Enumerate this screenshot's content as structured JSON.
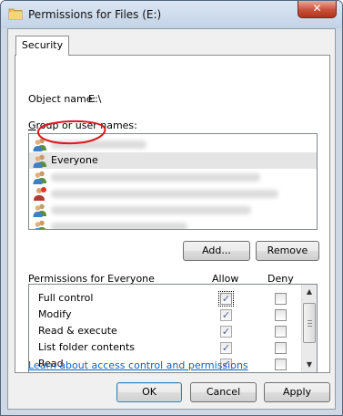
{
  "window": {
    "title": "Permissions for Files (E:)",
    "close_glyph": "✕"
  },
  "tabs": [
    {
      "label": "Security"
    }
  ],
  "object": {
    "label": "Object name:",
    "value": "E:\\"
  },
  "group_list": {
    "label": "Group or user names:",
    "label_underlined_char": "G",
    "items": [
      {
        "icon": "user-group-icon",
        "name": "",
        "selected": false
      },
      {
        "icon": "user-group-icon",
        "name": "Everyone",
        "selected": true
      },
      {
        "icon": "user-group-icon",
        "name": "",
        "selected": false
      },
      {
        "icon": "user-restricted-icon",
        "name": "",
        "selected": false
      },
      {
        "icon": "user-group-icon",
        "name": "",
        "selected": false
      },
      {
        "icon": "user-group-icon",
        "name": "",
        "selected": false
      }
    ]
  },
  "buttons": {
    "add": "Add...",
    "remove": "Remove",
    "ok": "OK",
    "cancel": "Cancel",
    "apply": "Apply"
  },
  "permissions": {
    "label": "Permissions for Everyone",
    "col_allow": "Allow",
    "col_deny": "Deny",
    "rows": [
      {
        "name": "Full control",
        "allow": true,
        "deny": false
      },
      {
        "name": "Modify",
        "allow": true,
        "deny": false
      },
      {
        "name": "Read & execute",
        "allow": true,
        "deny": false
      },
      {
        "name": "List folder contents",
        "allow": true,
        "deny": false
      },
      {
        "name": "Read",
        "allow": true,
        "deny": false
      }
    ]
  },
  "link": {
    "text": "Learn about access control and permissions"
  },
  "colors": {
    "annotation": "#d9191f",
    "link": "#0066cc",
    "checkmark": "#4a5f97"
  }
}
